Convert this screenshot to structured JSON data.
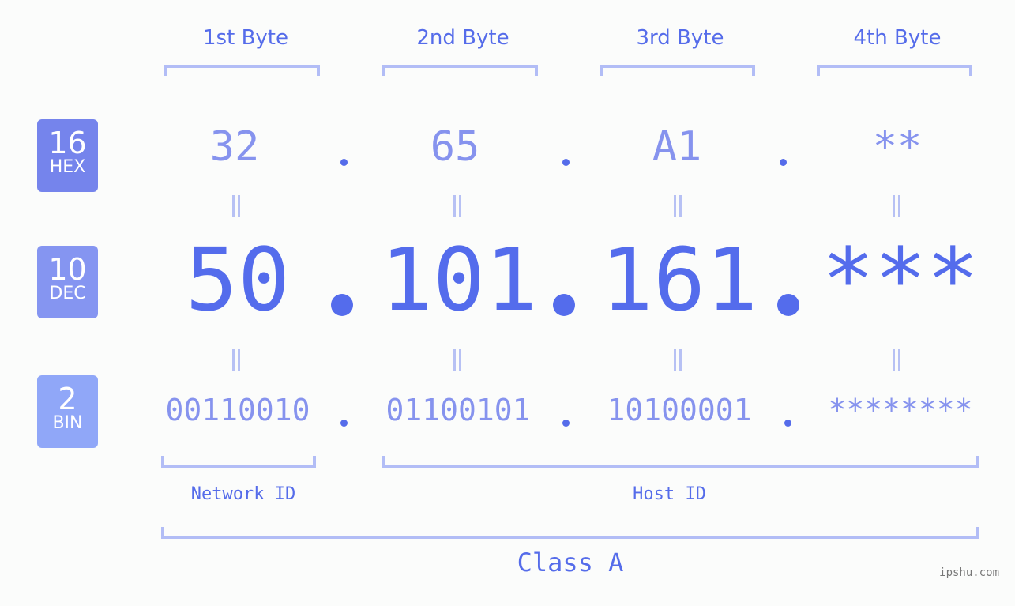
{
  "byte_headers": [
    "1st Byte",
    "2nd Byte",
    "3rd Byte",
    "4th Byte"
  ],
  "badges": {
    "hex": {
      "number": "16",
      "label": "HEX",
      "color": "#7584ec"
    },
    "dec": {
      "number": "10",
      "label": "DEC",
      "color": "#8595f1"
    },
    "bin": {
      "number": "2",
      "label": "BIN",
      "color": "#90a7f8"
    }
  },
  "hex_values": [
    "32",
    "65",
    "A1",
    "**"
  ],
  "dec_values": [
    "50",
    "101",
    "161",
    "***"
  ],
  "bin_values": [
    "00110010",
    "01100101",
    "10100001",
    "********"
  ],
  "segments": {
    "network_id": "Network ID",
    "host_id": "Host ID",
    "class": "Class A"
  },
  "watermark": "ipshu.com",
  "colors": {
    "primary": "#546cec",
    "secondary": "#8693ee",
    "bracket": "#b2bdf6",
    "background": "#fbfcfb"
  }
}
